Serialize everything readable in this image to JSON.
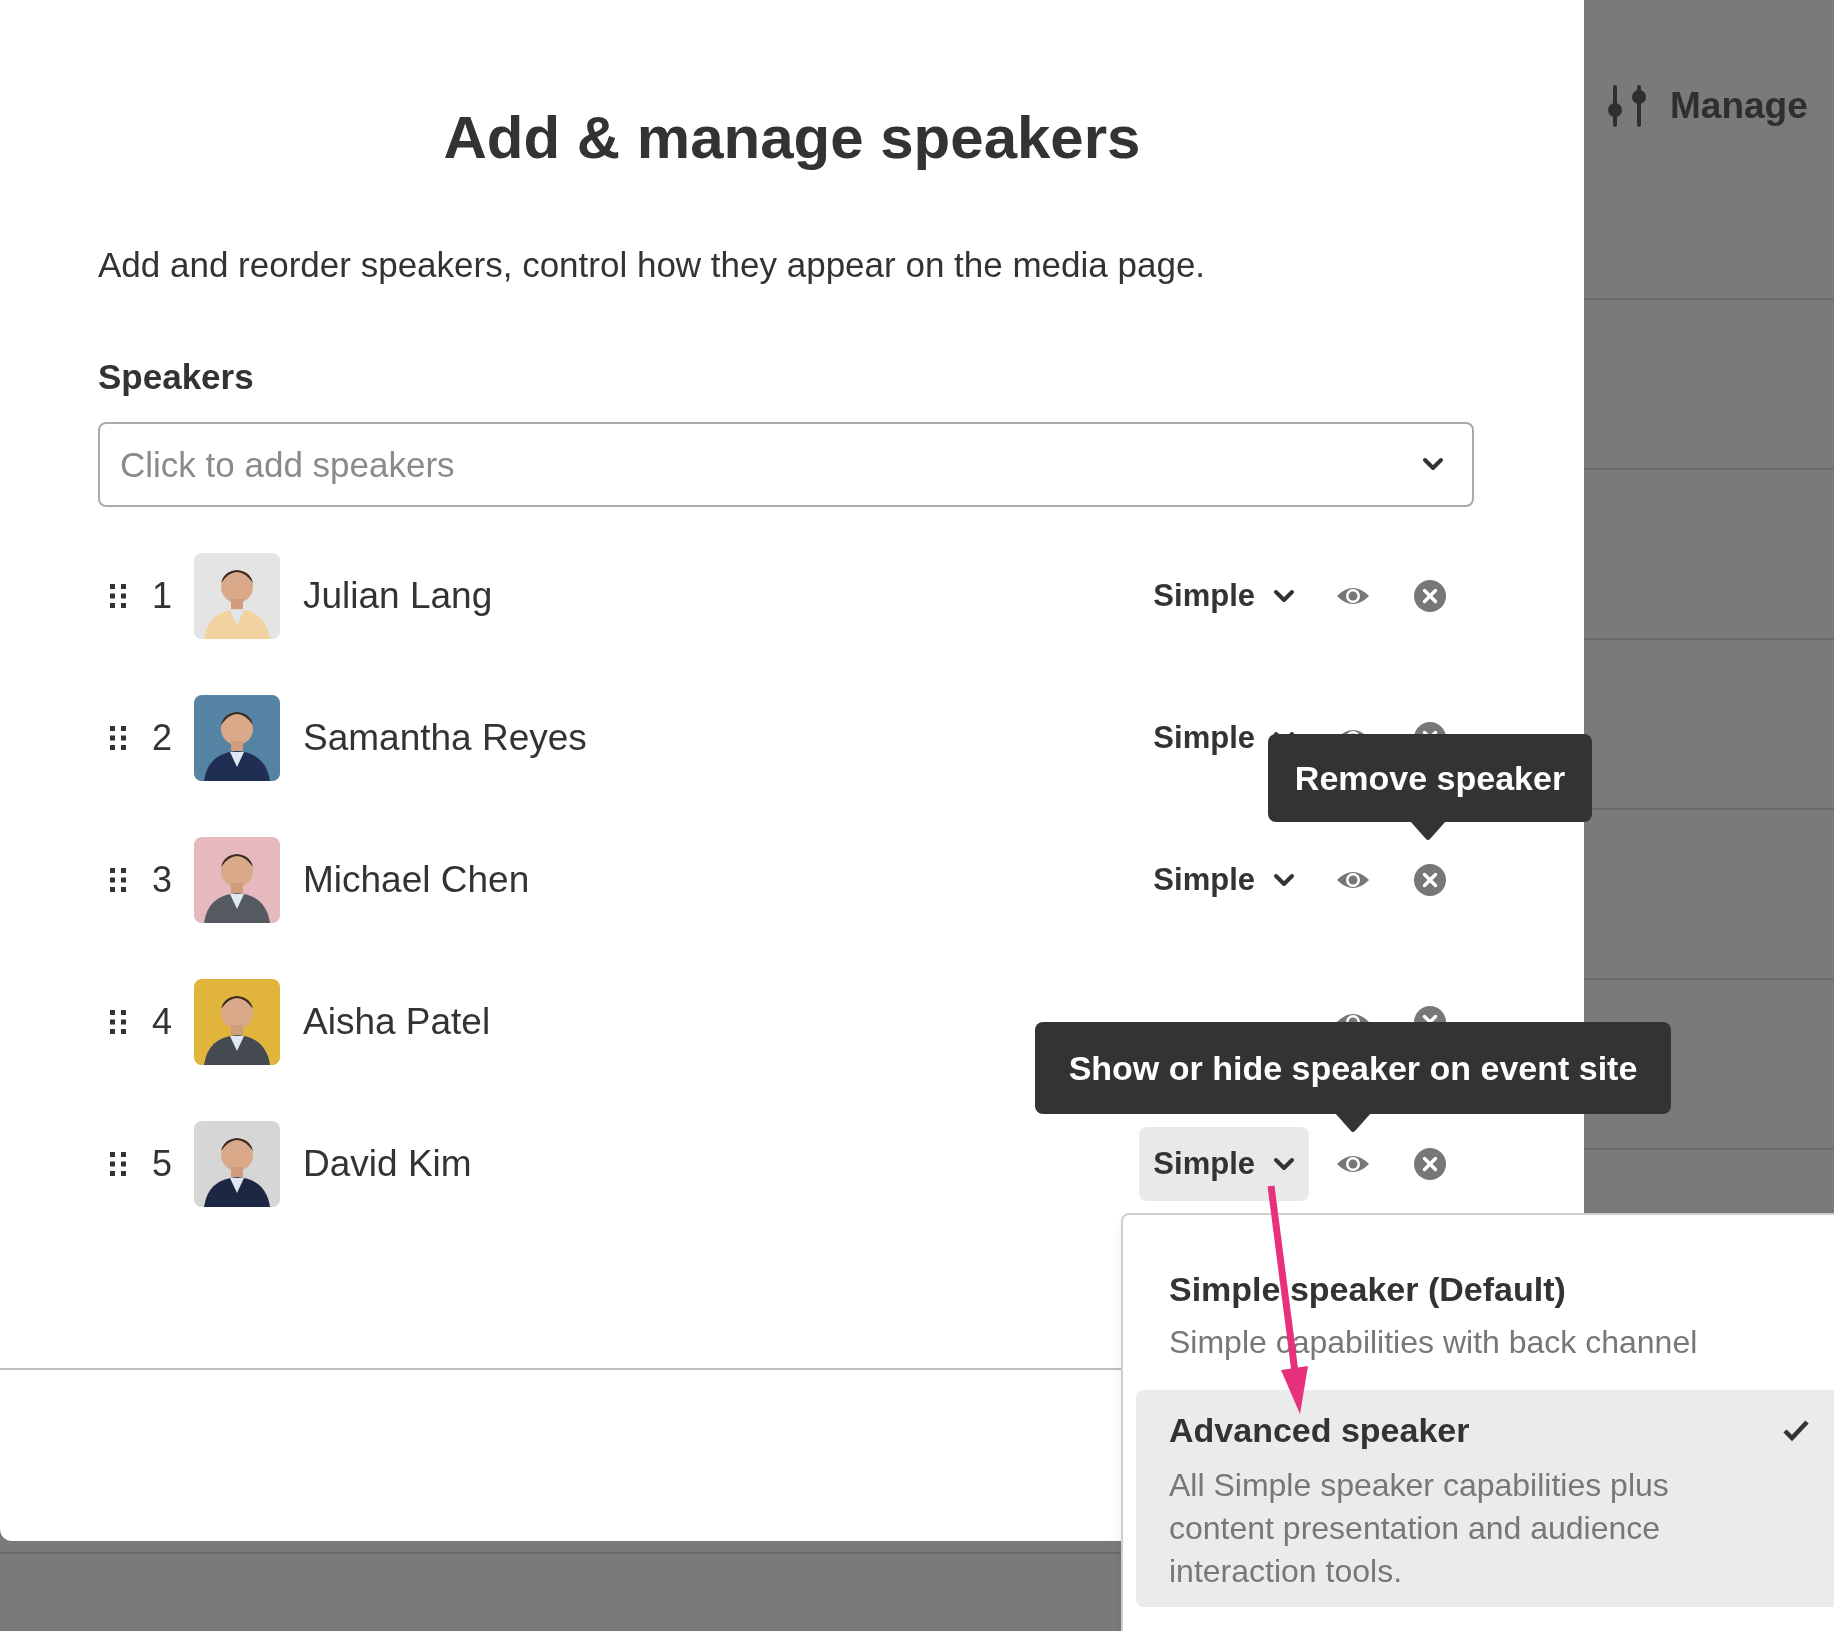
{
  "background_panel": {
    "title": "Manage"
  },
  "dialog": {
    "title": "Add & manage speakers",
    "description": "Add and reorder speakers, control how they appear on the media page.",
    "speakers_label": "Speakers",
    "speaker_field": {
      "placeholder": "Click to add speakers"
    },
    "speakers": [
      {
        "number": "1",
        "name": "Julian Lang",
        "role": "Simple",
        "visible": true
      },
      {
        "number": "2",
        "name": "Samantha Reyes",
        "role": "Simple",
        "visible": true
      },
      {
        "number": "3",
        "name": "Michael Chen",
        "role": "Simple",
        "visible": true
      },
      {
        "number": "4",
        "name": "Aisha Patel",
        "visible": true
      },
      {
        "number": "5",
        "name": "David Kim",
        "role": "Simple",
        "visible": true,
        "menu_open": true
      }
    ]
  },
  "tooltips": [
    {
      "text": "Remove speaker"
    },
    {
      "text": "Show or hide speaker on event site"
    }
  ],
  "role_menu": {
    "options": [
      {
        "title": "Simple speaker (Default)",
        "description": "Simple capabilities with back channel",
        "selected": false
      },
      {
        "title": "Advanced speaker",
        "description": "All Simple speaker capabilities plus content presentation and audience interaction tools.",
        "selected": true
      }
    ]
  }
}
